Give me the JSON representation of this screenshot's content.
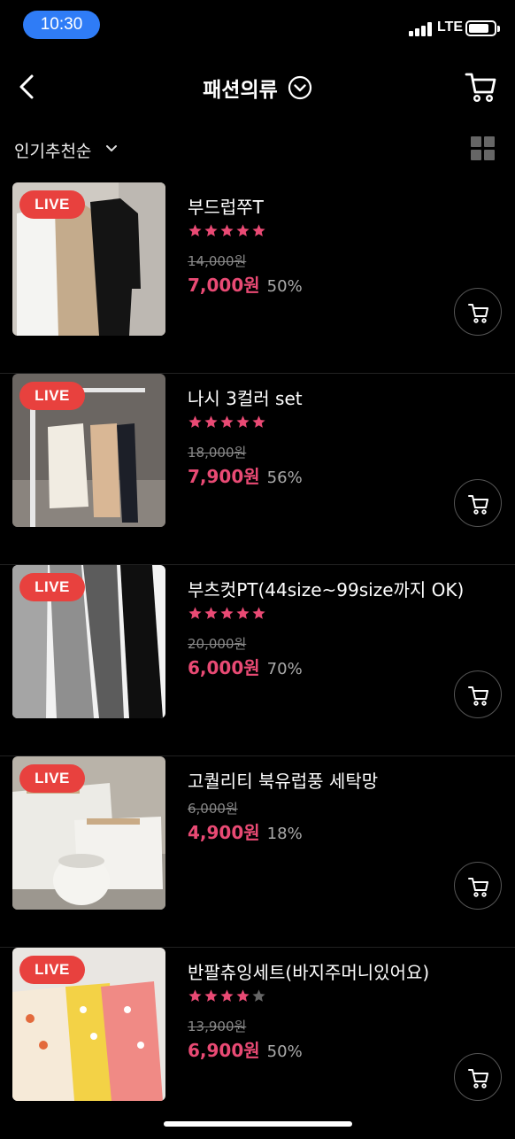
{
  "status_bar": {
    "time": "10:30",
    "network": "LTE"
  },
  "header": {
    "title": "패션의류"
  },
  "sort": {
    "label": "인기추천순"
  },
  "live_label": "LIVE",
  "items": [
    {
      "name": "부드럽쭈T",
      "rating": 5,
      "original_price": "14,000원",
      "price": "7,000원",
      "discount": "50%"
    },
    {
      "name": "나시 3컬러 set",
      "rating": 5,
      "original_price": "18,000원",
      "price": "7,900원",
      "discount": "56%"
    },
    {
      "name": "부츠컷PT(44size~99size까지 OK)",
      "rating": 5,
      "original_price": "20,000원",
      "price": "6,000원",
      "discount": "70%"
    },
    {
      "name": "고퀄리티 북유럽풍 세탁망",
      "rating": 0,
      "original_price": "6,000원",
      "price": "4,900원",
      "discount": "18%"
    },
    {
      "name": "반팔츄잉세트(바지주머니있어요)",
      "rating": 4,
      "original_price": "13,900원",
      "price": "6,900원",
      "discount": "50%"
    }
  ],
  "colors": {
    "accent_price": "#e94a74",
    "live_badge": "#e8413e",
    "star": "#e94a74",
    "time_pill": "#2f7cf6"
  },
  "icons": [
    "back-chevron-icon",
    "dropdown-circle-icon",
    "cart-icon",
    "grid-view-icon",
    "star-icon"
  ]
}
